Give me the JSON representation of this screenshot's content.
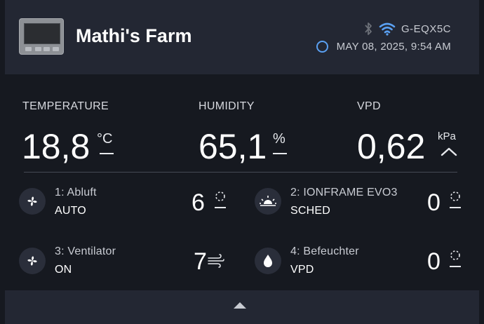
{
  "header": {
    "title": "Mathi's Farm",
    "device_id": "G-EQX5C",
    "datetime": "MAY 08, 2025, 9:54 AM",
    "icons": [
      "device-thumbnail",
      "bluetooth-icon",
      "wifi-icon",
      "clock-icon"
    ]
  },
  "metrics": {
    "temperature": {
      "label": "TEMPERATURE",
      "value": "18,8",
      "unit": "°C"
    },
    "humidity": {
      "label": "HUMIDITY",
      "value": "65,1",
      "unit": "%"
    },
    "vpd": {
      "label": "VPD",
      "value": "0,62",
      "unit": "kPa",
      "trend": "up"
    }
  },
  "ports": [
    {
      "name": "1: Abluft",
      "mode": "AUTO",
      "level": "6",
      "icon": "fan-icon",
      "level_icon": "dashed-circle-icon"
    },
    {
      "name": "2: IONFRAME EVO3",
      "mode": "SCHED",
      "level": "0",
      "icon": "sunrise-icon",
      "level_icon": "dashed-circle-icon"
    },
    {
      "name": "3: Ventilator",
      "mode": "ON",
      "level": "7",
      "icon": "fan-icon",
      "level_icon": "wind-icon"
    },
    {
      "name": "4: Befeuchter",
      "mode": "VPD",
      "level": "0",
      "icon": "droplet-icon",
      "level_icon": "dashed-circle-icon"
    }
  ],
  "colors": {
    "background": "#161920",
    "panel": "#232733",
    "accent_blue": "#5aa0f2",
    "text": "#ffffff",
    "muted_text": "#c8cbd2"
  }
}
